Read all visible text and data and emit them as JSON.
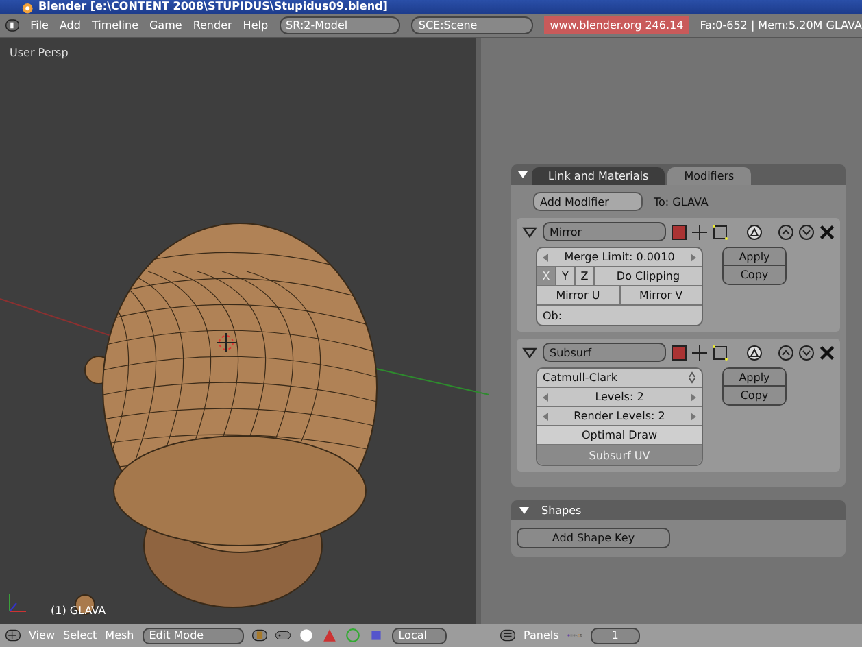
{
  "window": {
    "title": "Blender [e:\\CONTENT 2008\\STUPIDUS\\Stupidus09.blend]"
  },
  "menu": [
    "File",
    "Add",
    "Timeline",
    "Game",
    "Render",
    "Help"
  ],
  "screen_field": "SR:2-Model",
  "scene_field": "SCE:Scene",
  "version": "www.blender.org 246.14",
  "stats": "Fa:0-652 | Mem:5.20M GLAVA",
  "viewport": {
    "view_label": "User Persp",
    "object_label": "(1) GLAVA"
  },
  "viewport_header": {
    "menus": [
      "View",
      "Select",
      "Mesh"
    ],
    "mode": "Edit Mode",
    "orientation": "Local"
  },
  "editing": {
    "tabs": [
      {
        "label": "Link and Materials",
        "selected": false
      },
      {
        "label": "Modifiers",
        "selected": true
      }
    ],
    "add_modifier": "Add Modifier",
    "target": "To: GLAVA",
    "modifiers": [
      {
        "kind": "mirror",
        "name": "Mirror",
        "merge_limit": "Merge Limit: 0.0010",
        "axes": [
          {
            "label": "X",
            "selected": true
          },
          {
            "label": "Y",
            "selected": false
          },
          {
            "label": "Z",
            "selected": false
          }
        ],
        "clipping": "Do Clipping",
        "mirror_u": "Mirror U",
        "mirror_v": "Mirror V",
        "object": "Ob:",
        "apply": "Apply",
        "copy": "Copy"
      },
      {
        "kind": "subsurf",
        "name": "Subsurf",
        "type": "Catmull-Clark",
        "levels": "Levels: 2",
        "render_levels": "Render Levels: 2",
        "toggles": [
          {
            "label": "Optimal Draw",
            "on": false
          },
          {
            "label": "Subsurf UV",
            "on": true
          }
        ],
        "apply": "Apply",
        "copy": "Copy"
      }
    ]
  },
  "shapes": {
    "title": "Shapes",
    "button": "Add Shape Key"
  },
  "buttons_header": {
    "menu": "Panels",
    "frame": "1"
  }
}
